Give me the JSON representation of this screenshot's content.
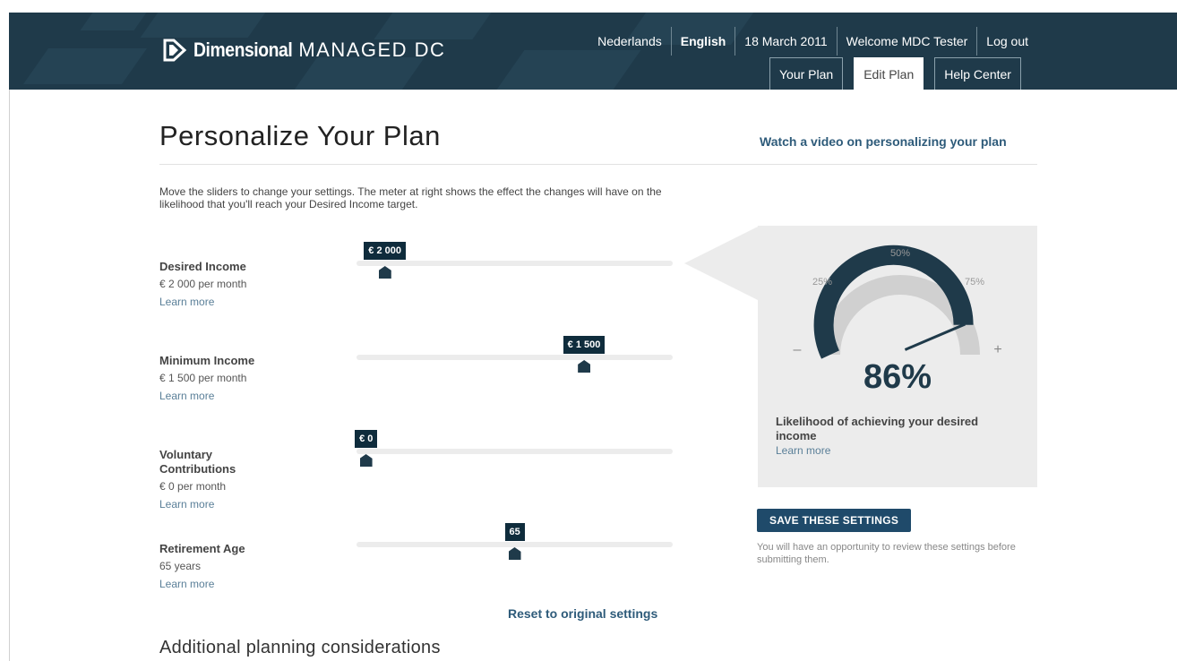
{
  "header": {
    "brand": "Dimensional",
    "product": "MANAGED DC",
    "nav": {
      "lang_nl": "Nederlands",
      "lang_en": "English",
      "date": "18 March 2011",
      "welcome": "Welcome MDC Tester",
      "logout": "Log out"
    },
    "tabs": [
      {
        "label": "Your Plan"
      },
      {
        "label": "Edit Plan"
      },
      {
        "label": "Help Center"
      }
    ]
  },
  "page": {
    "title": "Personalize Your Plan",
    "video_link": "Watch a video on personalizing your plan",
    "intro": "Move the sliders to change your settings. The meter at right shows the effect the changes will have on the likelihood that you'll reach your Desired Income target."
  },
  "settings": [
    {
      "label": "Desired Income",
      "value": "€ 2 000 per month",
      "link": "Learn more",
      "bubble": "€ 2 000",
      "level": 0.09
    },
    {
      "label": "Minimum Income",
      "value": "€ 1 500 per month",
      "link": "Learn more",
      "bubble": "€ 1 500",
      "level": 0.72
    },
    {
      "label": "Voluntary Contributions",
      "value": "€ 0 per month",
      "link": "Learn more",
      "bubble": "€ 0",
      "level": 0.03
    },
    {
      "label": "Retirement Age",
      "value": "65 years",
      "link": "Learn more",
      "bubble": "65",
      "level": 0.5
    }
  ],
  "reset_link": "Reset to original settings",
  "additional_title": "Additional planning considerations",
  "meter": {
    "value_text": "86%",
    "value": 86,
    "ticks": [
      "25%",
      "50%",
      "75%"
    ],
    "minus": "–",
    "plus": "+",
    "caption": "Likelihood of achieving your desired income",
    "link": "Learn more",
    "fill_color": "#1f3a4a",
    "track_color": "#d0d0d0"
  },
  "save": {
    "label": "SAVE THESE SETTINGS",
    "note": "You will have an opportunity to review these settings before submitting them."
  }
}
